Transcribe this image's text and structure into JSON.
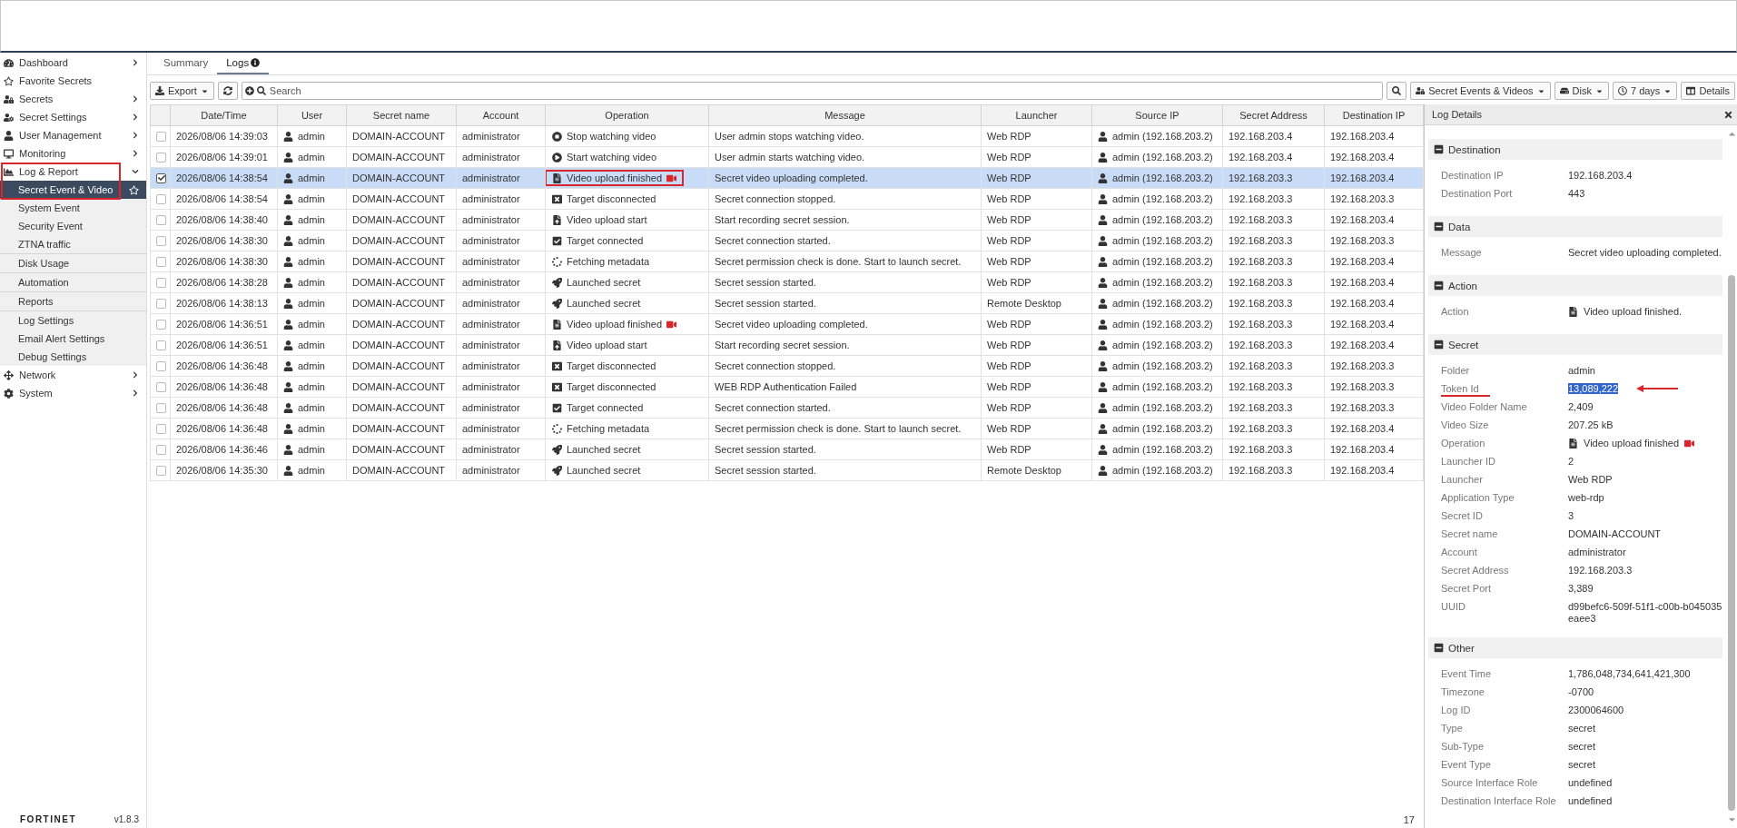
{
  "sidebar": {
    "items": [
      {
        "label": "Dashboard",
        "expanded": false,
        "selected": false
      },
      {
        "label": "Favorite Secrets",
        "selected": false
      },
      {
        "label": "Secrets",
        "expanded": false,
        "selected": false
      },
      {
        "label": "Secret Settings",
        "expanded": false,
        "selected": false
      },
      {
        "label": "User Management",
        "expanded": false,
        "selected": false
      },
      {
        "label": "Monitoring",
        "expanded": false,
        "selected": false
      },
      {
        "label": "Log & Report",
        "expanded": true,
        "selected": false,
        "annotated": true,
        "children": [
          {
            "label": "Secret Event & Video",
            "selected": true,
            "separated": false
          },
          {
            "label": "System Event",
            "selected": false,
            "separated": false
          },
          {
            "label": "Security Event",
            "selected": false,
            "separated": false
          },
          {
            "label": "ZTNA traffic",
            "selected": false,
            "separated": false
          },
          {
            "label": "Disk Usage",
            "selected": false,
            "separated": true
          },
          {
            "label": "Automation",
            "selected": false,
            "separated": true
          },
          {
            "label": "Reports",
            "selected": false,
            "separated": true
          },
          {
            "label": "Log Settings",
            "selected": false,
            "separated": true
          },
          {
            "label": "Email Alert Settings",
            "selected": false,
            "separated": false
          },
          {
            "label": "Debug Settings",
            "selected": false,
            "separated": false
          }
        ]
      },
      {
        "label": "Network",
        "expanded": false,
        "selected": false
      },
      {
        "label": "System",
        "expanded": false,
        "selected": false
      }
    ],
    "logo": "FORTINET",
    "version": "v1.8.3"
  },
  "tabs": [
    {
      "label": "Summary",
      "selected": false
    },
    {
      "label": "Logs",
      "selected": true,
      "info": true
    }
  ],
  "toolbar": {
    "export": "Export",
    "search": {
      "placeholder": "Search"
    },
    "filter": "Secret Events & Videos",
    "storage": "Disk",
    "period": "7 days",
    "details": "Details"
  },
  "table": {
    "columns": [
      "Date/Time",
      "User",
      "Secret name",
      "Account",
      "Operation",
      "Message",
      "Launcher",
      "Source IP",
      "Secret Address",
      "Destination IP"
    ],
    "rows": [
      {
        "selected": false,
        "datetime": "2026/08/06 14:39:03",
        "user": "admin",
        "secret_name": "DOMAIN-ACCOUNT",
        "account": "administrator",
        "operation": {
          "kind": "stop",
          "text": "Stop watching video"
        },
        "message": "User admin stops watching video.",
        "launcher": "Web RDP",
        "source_ip": "admin (192.168.203.2)",
        "secret_address": "192.168.203.4",
        "destination_ip": "192.168.203.4"
      },
      {
        "selected": false,
        "datetime": "2026/08/06 14:39:01",
        "user": "admin",
        "secret_name": "DOMAIN-ACCOUNT",
        "account": "administrator",
        "operation": {
          "kind": "play",
          "text": "Start watching video"
        },
        "message": "User admin starts watching video.",
        "launcher": "Web RDP",
        "source_ip": "admin (192.168.203.2)",
        "secret_address": "192.168.203.4",
        "destination_ip": "192.168.203.4"
      },
      {
        "selected": true,
        "annotated": true,
        "datetime": "2026/08/06 14:38:54",
        "user": "admin",
        "secret_name": "DOMAIN-ACCOUNT",
        "account": "administrator",
        "operation": {
          "kind": "file",
          "text": "Video upload finished",
          "video": true
        },
        "message": "Secret video uploading completed.",
        "launcher": "Web RDP",
        "source_ip": "admin (192.168.203.2)",
        "secret_address": "192.168.203.3",
        "destination_ip": "192.168.203.4"
      },
      {
        "selected": false,
        "datetime": "2026/08/06 14:38:54",
        "user": "admin",
        "secret_name": "DOMAIN-ACCOUNT",
        "account": "administrator",
        "operation": {
          "kind": "close",
          "text": "Target disconnected"
        },
        "message": "Secret connection stopped.",
        "launcher": "Web RDP",
        "source_ip": "admin (192.168.203.2)",
        "secret_address": "192.168.203.3",
        "destination_ip": "192.168.203.3"
      },
      {
        "selected": false,
        "datetime": "2026/08/06 14:38:40",
        "user": "admin",
        "secret_name": "DOMAIN-ACCOUNT",
        "account": "administrator",
        "operation": {
          "kind": "upload",
          "text": "Video upload start"
        },
        "message": "Start recording secret session.",
        "launcher": "Web RDP",
        "source_ip": "admin (192.168.203.2)",
        "secret_address": "192.168.203.3",
        "destination_ip": "192.168.203.4"
      },
      {
        "selected": false,
        "datetime": "2026/08/06 14:38:30",
        "user": "admin",
        "secret_name": "DOMAIN-ACCOUNT",
        "account": "administrator",
        "operation": {
          "kind": "check",
          "text": "Target connected"
        },
        "message": "Secret connection started.",
        "launcher": "Web RDP",
        "source_ip": "admin (192.168.203.2)",
        "secret_address": "192.168.203.3",
        "destination_ip": "192.168.203.3"
      },
      {
        "selected": false,
        "datetime": "2026/08/06 14:38:30",
        "user": "admin",
        "secret_name": "DOMAIN-ACCOUNT",
        "account": "administrator",
        "operation": {
          "kind": "spinner",
          "text": "Fetching metadata"
        },
        "message": "Secret permission check is done. Start to launch secret.",
        "launcher": "Web RDP",
        "source_ip": "admin (192.168.203.2)",
        "secret_address": "192.168.203.3",
        "destination_ip": "192.168.203.4"
      },
      {
        "selected": false,
        "datetime": "2026/08/06 14:38:28",
        "user": "admin",
        "secret_name": "DOMAIN-ACCOUNT",
        "account": "administrator",
        "operation": {
          "kind": "rocket",
          "text": "Launched secret"
        },
        "message": "Secret session started.",
        "launcher": "Web RDP",
        "source_ip": "admin (192.168.203.2)",
        "secret_address": "192.168.203.3",
        "destination_ip": "192.168.203.4"
      },
      {
        "selected": false,
        "datetime": "2026/08/06 14:38:13",
        "user": "admin",
        "secret_name": "DOMAIN-ACCOUNT",
        "account": "administrator",
        "operation": {
          "kind": "rocket",
          "text": "Launched secret"
        },
        "message": "Secret session started.",
        "launcher": "Remote Desktop",
        "source_ip": "admin (192.168.203.2)",
        "secret_address": "192.168.203.3",
        "destination_ip": "192.168.203.4"
      },
      {
        "selected": false,
        "datetime": "2026/08/06 14:36:51",
        "user": "admin",
        "secret_name": "DOMAIN-ACCOUNT",
        "account": "administrator",
        "operation": {
          "kind": "file",
          "text": "Video upload finished",
          "video": true
        },
        "message": "Secret video uploading completed.",
        "launcher": "Web RDP",
        "source_ip": "admin (192.168.203.2)",
        "secret_address": "192.168.203.3",
        "destination_ip": "192.168.203.4"
      },
      {
        "selected": false,
        "datetime": "2026/08/06 14:36:51",
        "user": "admin",
        "secret_name": "DOMAIN-ACCOUNT",
        "account": "administrator",
        "operation": {
          "kind": "upload",
          "text": "Video upload start"
        },
        "message": "Start recording secret session.",
        "launcher": "Web RDP",
        "source_ip": "admin (192.168.203.2)",
        "secret_address": "192.168.203.3",
        "destination_ip": "192.168.203.4"
      },
      {
        "selected": false,
        "datetime": "2026/08/06 14:36:48",
        "user": "admin",
        "secret_name": "DOMAIN-ACCOUNT",
        "account": "administrator",
        "operation": {
          "kind": "close",
          "text": "Target disconnected"
        },
        "message": "Secret connection stopped.",
        "launcher": "Web RDP",
        "source_ip": "admin (192.168.203.2)",
        "secret_address": "192.168.203.3",
        "destination_ip": "192.168.203.3"
      },
      {
        "selected": false,
        "datetime": "2026/08/06 14:36:48",
        "user": "admin",
        "secret_name": "DOMAIN-ACCOUNT",
        "account": "administrator",
        "operation": {
          "kind": "close",
          "text": "Target disconnected"
        },
        "message": "WEB RDP Authentication Failed",
        "launcher": "Web RDP",
        "source_ip": "admin (192.168.203.2)",
        "secret_address": "192.168.203.3",
        "destination_ip": "192.168.203.3"
      },
      {
        "selected": false,
        "datetime": "2026/08/06 14:36:48",
        "user": "admin",
        "secret_name": "DOMAIN-ACCOUNT",
        "account": "administrator",
        "operation": {
          "kind": "check",
          "text": "Target connected"
        },
        "message": "Secret connection started.",
        "launcher": "Web RDP",
        "source_ip": "admin (192.168.203.2)",
        "secret_address": "192.168.203.3",
        "destination_ip": "192.168.203.3"
      },
      {
        "selected": false,
        "datetime": "2026/08/06 14:36:48",
        "user": "admin",
        "secret_name": "DOMAIN-ACCOUNT",
        "account": "administrator",
        "operation": {
          "kind": "spinner",
          "text": "Fetching metadata"
        },
        "message": "Secret permission check is done. Start to launch secret.",
        "launcher": "Web RDP",
        "source_ip": "admin (192.168.203.2)",
        "secret_address": "192.168.203.3",
        "destination_ip": "192.168.203.4"
      },
      {
        "selected": false,
        "datetime": "2026/08/06 14:36:46",
        "user": "admin",
        "secret_name": "DOMAIN-ACCOUNT",
        "account": "administrator",
        "operation": {
          "kind": "rocket",
          "text": "Launched secret"
        },
        "message": "Secret session started.",
        "launcher": "Web RDP",
        "source_ip": "admin (192.168.203.2)",
        "secret_address": "192.168.203.3",
        "destination_ip": "192.168.203.4"
      },
      {
        "selected": false,
        "datetime": "2026/08/06 14:35:30",
        "user": "admin",
        "secret_name": "DOMAIN-ACCOUNT",
        "account": "administrator",
        "operation": {
          "kind": "rocket",
          "text": "Launched secret"
        },
        "message": "Secret session started.",
        "launcher": "Remote Desktop",
        "source_ip": "admin (192.168.203.2)",
        "secret_address": "192.168.203.3",
        "destination_ip": "192.168.203.4"
      }
    ],
    "count": "17"
  },
  "details": {
    "title": "Log Details",
    "sections": [
      {
        "title": "Destination",
        "fields": [
          {
            "kind": "text",
            "label": "Destination IP",
            "value": "192.168.203.4"
          },
          {
            "kind": "text",
            "label": "Destination Port",
            "value": "443"
          }
        ]
      },
      {
        "title": "Data",
        "fields": [
          {
            "kind": "text",
            "label": "Message",
            "value": "Secret video uploading completed."
          }
        ]
      },
      {
        "title": "Action",
        "fields": [
          {
            "kind": "operation",
            "label": "Action",
            "value": "Video upload finished."
          }
        ]
      },
      {
        "title": "Secret",
        "fields": [
          {
            "kind": "text",
            "label": "Folder",
            "value": "admin"
          },
          {
            "kind": "annotated",
            "label": "Token Id",
            "value": "13,089,222"
          },
          {
            "kind": "text",
            "label": "Video Folder Name",
            "value": "2,409"
          },
          {
            "kind": "text",
            "label": "Video Size",
            "value": "207.25 kB"
          },
          {
            "kind": "operation",
            "label": "Operation",
            "value": "Video upload finished",
            "video": true
          },
          {
            "kind": "text",
            "label": "Launcher ID",
            "value": "2"
          },
          {
            "kind": "text",
            "label": "Launcher",
            "value": "Web RDP"
          },
          {
            "kind": "text",
            "label": "Application Type",
            "value": "web-rdp"
          },
          {
            "kind": "text",
            "label": "Secret ID",
            "value": "3"
          },
          {
            "kind": "text",
            "label": "Secret name",
            "value": "DOMAIN-ACCOUNT"
          },
          {
            "kind": "text",
            "label": "Account",
            "value": "administrator"
          },
          {
            "kind": "text",
            "label": "Secret Address",
            "value": "192.168.203.3"
          },
          {
            "kind": "text",
            "label": "Secret Port",
            "value": "3,389"
          },
          {
            "kind": "text",
            "label": "UUID",
            "value": "d99befc6-509f-51f1-c00b-b045035eaee3"
          }
        ]
      },
      {
        "title": "Other",
        "fields": [
          {
            "kind": "text",
            "label": "Event Time",
            "value": "1,786,048,734,641,421,300"
          },
          {
            "kind": "text",
            "label": "Timezone",
            "value": "-0700"
          },
          {
            "kind": "text",
            "label": "Log ID",
            "value": "2300064600"
          },
          {
            "kind": "text",
            "label": "Type",
            "value": "secret"
          },
          {
            "kind": "text",
            "label": "Sub-Type",
            "value": "secret"
          },
          {
            "kind": "text",
            "label": "Event Type",
            "value": "secret"
          },
          {
            "kind": "text",
            "label": "Source Interface Role",
            "value": "undefined"
          },
          {
            "kind": "text",
            "label": "Destination Interface Role",
            "value": "undefined"
          }
        ]
      }
    ]
  }
}
